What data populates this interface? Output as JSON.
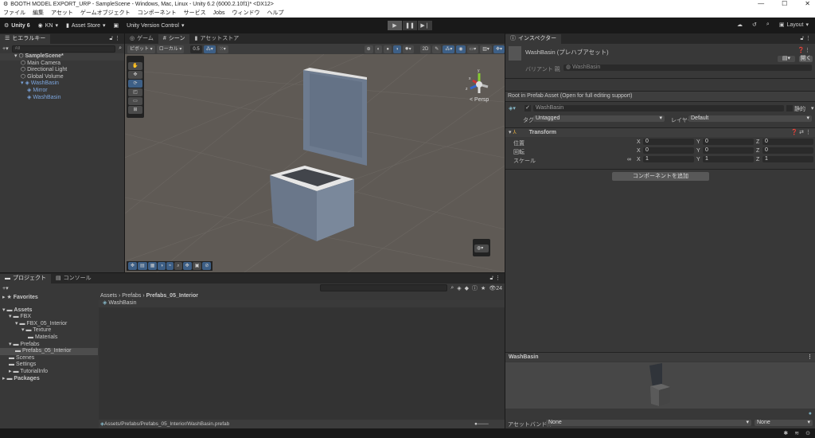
{
  "window": {
    "title": "BOOTH MODEL EXPORT_URP - SampleScene - Windows, Mac, Linux - Unity 6.2 (6000.2.10f1)* <DX12>",
    "controls": [
      "—",
      "☐",
      "✕"
    ]
  },
  "menu": [
    "ファイル",
    "編集",
    "アセット",
    "ゲームオブジェクト",
    "コンポーネント",
    "サービス",
    "Jobs",
    "ウィンドウ",
    "ヘルプ"
  ],
  "toolbar": {
    "unity": "Unity 6",
    "account": "KN",
    "asset_store": "Asset Store",
    "version_control": "Unity Version Control",
    "layout": "Layout"
  },
  "hierarchy": {
    "tab": "ヒエラルキー",
    "search_placeholder": "All",
    "items": [
      {
        "label": "SampleScene*",
        "depth": 0
      },
      {
        "label": "Main Camera",
        "depth": 1
      },
      {
        "label": "Directional Light",
        "depth": 1
      },
      {
        "label": "Global Volume",
        "depth": 1
      },
      {
        "label": "WashBasin",
        "depth": 1,
        "prefab": true
      },
      {
        "label": "Mirror",
        "depth": 2,
        "prefab": true
      },
      {
        "label": "WashBasin",
        "depth": 2,
        "prefab": true
      }
    ]
  },
  "scene": {
    "tabs": [
      "ゲーム",
      "シーン",
      "アセットストア"
    ],
    "pivot": "ピボット",
    "local": "ローカル",
    "snap": "0.5",
    "persp": "< Persp",
    "gizmo_axes": [
      "y",
      "x",
      "z"
    ]
  },
  "inspector": {
    "tab": "インスペクター",
    "title": "WashBasin (プレハブアセット)",
    "open_button": "開く",
    "variant_label": "バリアント 親",
    "variant_value": "WashBasin",
    "root_note": "Root in Prefab Asset (Open for full editing support)",
    "name": "WashBasin",
    "static_label": "静的",
    "tag_label": "タグ",
    "tag_value": "Untagged",
    "layer_label": "レイヤー",
    "layer_value": "Default",
    "transform": {
      "title": "Transform",
      "rows": [
        {
          "label": "位置",
          "x": "0",
          "y": "0",
          "z": "0"
        },
        {
          "label": "回転",
          "x": "0",
          "y": "0",
          "z": "0"
        },
        {
          "label": "スケール",
          "x": "1",
          "y": "1",
          "z": "1"
        }
      ]
    },
    "add_component": "コンポーネントを追加",
    "preview_title": "WashBasin",
    "assetbundle_label": "アセットバンドル",
    "assetbundle_value": "None",
    "assetbundle_variant": "None"
  },
  "project": {
    "tabs": [
      "プロジェクト",
      "コンソール"
    ],
    "tree": [
      {
        "label": "Favorites",
        "depth": 0,
        "bold": true
      },
      {
        "label": "Assets",
        "depth": 0,
        "bold": true
      },
      {
        "label": "FBX",
        "depth": 1
      },
      {
        "label": "FBX_05_Interior",
        "depth": 2
      },
      {
        "label": "Texture",
        "depth": 3
      },
      {
        "label": "Materials",
        "depth": 4
      },
      {
        "label": "Prefabs",
        "depth": 1
      },
      {
        "label": "Prefabs_05_Interior",
        "depth": 2,
        "selected": true
      },
      {
        "label": "Scenes",
        "depth": 1
      },
      {
        "label": "Settings",
        "depth": 1
      },
      {
        "label": "TutorialInfo",
        "depth": 1
      },
      {
        "label": "Packages",
        "depth": 0,
        "bold": true
      }
    ],
    "breadcrumb": [
      "Assets",
      "Prefabs",
      "Prefabs_05_Interior"
    ],
    "files": [
      "WashBasin"
    ],
    "hidden_count": "24",
    "path": "Assets/Prefabs/Prefabs_05_Interior/WashBasin.prefab"
  }
}
